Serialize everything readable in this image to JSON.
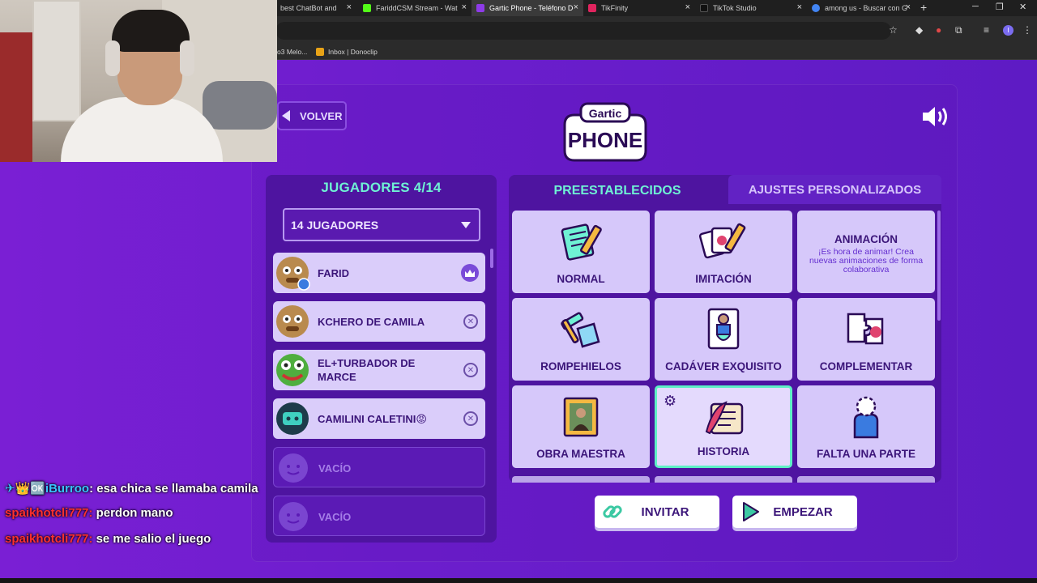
{
  "browser": {
    "tabs": [
      {
        "title": "best ChatBot and Wi",
        "color": "#6a6a6a",
        "active": false
      },
      {
        "title": "FariddCSM Stream - Wat",
        "color": "#53fc18",
        "active": false
      },
      {
        "title": "Gartic Phone - Teléfono D",
        "color": "#8e3be8",
        "active": true
      },
      {
        "title": "TikFinity",
        "color": "#e0245e",
        "active": false
      },
      {
        "title": "TikTok Studio",
        "color": "#111111",
        "active": false
      },
      {
        "title": "among us - Buscar con G",
        "color": "#4285f4",
        "active": false
      }
    ],
    "close_glyph": "×",
    "newtab_glyph": "+",
    "profile_initial": "I",
    "bookmarks": [
      "o3 Melo...",
      "Inbox | Donoclip"
    ]
  },
  "page": {
    "back_label": "VOLVER",
    "logo": {
      "line1": "Gartic",
      "line2": "PHONE"
    },
    "sound_icon": "speaker-icon"
  },
  "players": {
    "title": "JUGADORES 4/14",
    "count_select": "14 JUGADORES",
    "list": [
      {
        "name": "FARID",
        "type": "host",
        "avatar_color": "#b98a4e"
      },
      {
        "name": "KCHERO DE CAMILA",
        "type": "guest",
        "avatar_color": "#b98a4e"
      },
      {
        "name": "EL+TURBADOR DE MARCE",
        "type": "guest",
        "avatar_color": "#4fae3f"
      },
      {
        "name": "CAMILINI CALETINI😡",
        "type": "guest",
        "avatar_color": "#1d3b4a"
      },
      {
        "name": "VACÍO",
        "type": "empty",
        "avatar_color": "#7a45d0"
      },
      {
        "name": "VACÍO",
        "type": "empty",
        "avatar_color": "#7a45d0"
      }
    ]
  },
  "settings": {
    "tab_preset": "PREESTABLECIDOS",
    "tab_custom": "AJUSTES PERSONALIZADOS",
    "modes": [
      {
        "label": "NORMAL",
        "icon": "notepad-pencil-icon"
      },
      {
        "label": "IMITACIÓN",
        "icon": "cards-pencil-icon"
      },
      {
        "label": "ANIMACIÓN",
        "icon": "",
        "desc": "¡Es hora de animar! Crea nuevas animaciones de forma colaborativa"
      },
      {
        "label": "ROMPEHIELOS",
        "icon": "ice-hammer-icon"
      },
      {
        "label": "CADÁVER EXQUISITO",
        "icon": "corpse-drawing-icon"
      },
      {
        "label": "COMPLEMENTAR",
        "icon": "puzzle-icon"
      },
      {
        "label": "OBRA MAESTRA",
        "icon": "painting-icon"
      },
      {
        "label": "HISTORIA",
        "icon": "scroll-quill-icon",
        "selected": true
      },
      {
        "label": "FALTA UNA PARTE",
        "icon": "missing-part-icon"
      }
    ],
    "invite_label": "INVITAR",
    "start_label": "EMPEZAR"
  },
  "chat": [
    {
      "user": "iBurroo",
      "badges": "✈👑🆗",
      "message": "esa chica se llamaba camila",
      "color": "#39c4ff"
    },
    {
      "user": "spaikhotcli777",
      "badges": "",
      "message": "perdon mano",
      "color": "#ff3030"
    },
    {
      "user": "spaikhotcli777",
      "badges": "",
      "message": "se me salio el juego",
      "color": "#ff3030"
    }
  ]
}
